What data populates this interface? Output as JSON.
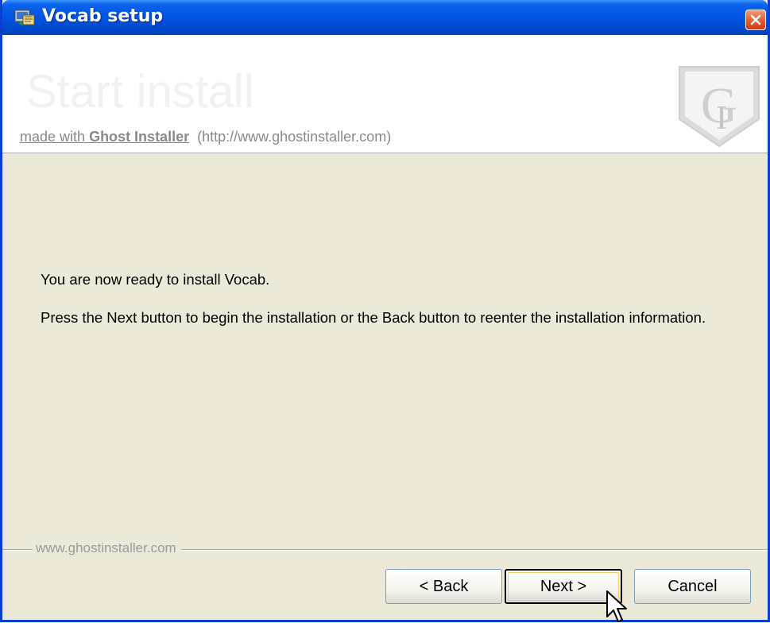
{
  "window": {
    "title": "Vocab setup",
    "icons": {
      "app": "setup-icon",
      "close": "close-icon"
    }
  },
  "header": {
    "title": "Start install",
    "made_with": "made with",
    "brand": "Ghost Installer",
    "url": "(http://www.ghostinstaller.com)",
    "logo": "ghost-installer-logo"
  },
  "content": {
    "line1": "You are now ready to install Vocab.",
    "line2": "Press the Next button to begin the installation or the Back button to reenter the installation information."
  },
  "footer": {
    "label": "www.ghostinstaller.com"
  },
  "buttons": {
    "back": "< Back",
    "next": "Next >",
    "cancel": "Cancel"
  },
  "colors": {
    "titlebar": "#0054e3",
    "dialog_bg": "#ece9d8",
    "close_button": "#e35b2e",
    "focus_ring": "#f7c968"
  },
  "cursor": "arrow-pointer-icon"
}
